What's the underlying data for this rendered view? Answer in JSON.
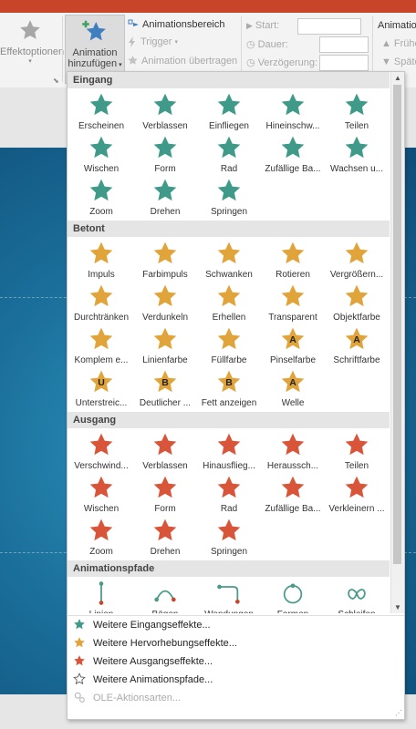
{
  "ribbon": {
    "effektoptionen": "Effektoptionen",
    "add_animation_line1": "Animation",
    "add_animation_line2": "hinzufügen",
    "animationsbereich": "Animationsbereich",
    "trigger": "Trigger",
    "animation_uebertragen": "Animation übertragen",
    "start_label": "Start:",
    "dauer_label": "Dauer:",
    "verzoegerung_label": "Verzögerung:",
    "animation_right": "Animatio",
    "frueher": "Frühe",
    "spaeter": "Späte"
  },
  "colors": {
    "entrance": "#3f9a8a",
    "emphasis": "#e0a43a",
    "exit": "#d9553a",
    "path": "#4a9a8a",
    "accent_titlebar": "#c8452a"
  },
  "sections": {
    "eingang": {
      "title": "Eingang",
      "items": [
        "Erscheinen",
        "Verblassen",
        "Einfliegen",
        "Hineinschw...",
        "Teilen",
        "Wischen",
        "Form",
        "Rad",
        "Zufällige Ba...",
        "Wachsen u...",
        "Zoom",
        "Drehen",
        "Springen"
      ]
    },
    "betont": {
      "title": "Betont",
      "items": [
        "Impuls",
        "Farbimpuls",
        "Schwanken",
        "Rotieren",
        "Vergrößern...",
        "Durchtränken",
        "Verdunkeln",
        "Erhellen",
        "Transparent",
        "Objektfarbe",
        "Komplem e...",
        "Linienfarbe",
        "Füllfarbe",
        "Pinselfarbe",
        "Schriftfarbe",
        "Unterstreic...",
        "Deutlicher ...",
        "Fett anzeigen",
        "Welle"
      ],
      "letters": {
        "13": "A",
        "14": "A",
        "15": "U",
        "16": "B",
        "17": "B",
        "18": "A"
      }
    },
    "ausgang": {
      "title": "Ausgang",
      "items": [
        "Verschwind...",
        "Verblassen",
        "Hinausflieg...",
        "Heraussch...",
        "Teilen",
        "Wischen",
        "Form",
        "Rad",
        "Zufällige Ba...",
        "Verkleinern ...",
        "Zoom",
        "Drehen",
        "Springen"
      ]
    },
    "pfade": {
      "title": "Animationspfade",
      "items": [
        "Linien",
        "Bögen",
        "Wendungen",
        "Formen",
        "Schleifen"
      ]
    }
  },
  "more": [
    {
      "label": "Weitere Eingangseffekte...",
      "icon": "star-green-icon"
    },
    {
      "label": "Weitere Hervorhebungseffekte...",
      "icon": "star-yellow-icon"
    },
    {
      "label": "Weitere Ausgangseffekte...",
      "icon": "star-red-icon"
    },
    {
      "label": "Weitere Animationspfade...",
      "icon": "star-outline-icon"
    },
    {
      "label": "OLE-Aktionsarten...",
      "icon": "gears-icon",
      "disabled": true
    }
  ]
}
